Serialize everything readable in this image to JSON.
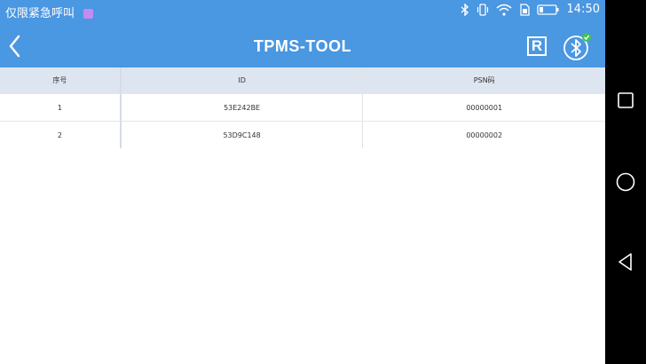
{
  "status_bar": {
    "carrier_text": "仅限紧急呼叫",
    "time": "14:50",
    "icons": [
      "bluetooth-icon",
      "vibrate-icon",
      "wifi-icon",
      "sim-icon",
      "battery-icon"
    ]
  },
  "app_bar": {
    "title": "TPMS-TOOL",
    "r_button_label": "R"
  },
  "table": {
    "headers": [
      "序号",
      "ID",
      "PSN码"
    ],
    "rows": [
      [
        "1",
        "53E242BE",
        "00000001"
      ],
      [
        "2",
        "53D9C148",
        "00000002"
      ]
    ]
  },
  "colors": {
    "primary": "#4a97e2",
    "header_bg": "#dde6f0",
    "bluetooth_badge": "#43c05a"
  }
}
